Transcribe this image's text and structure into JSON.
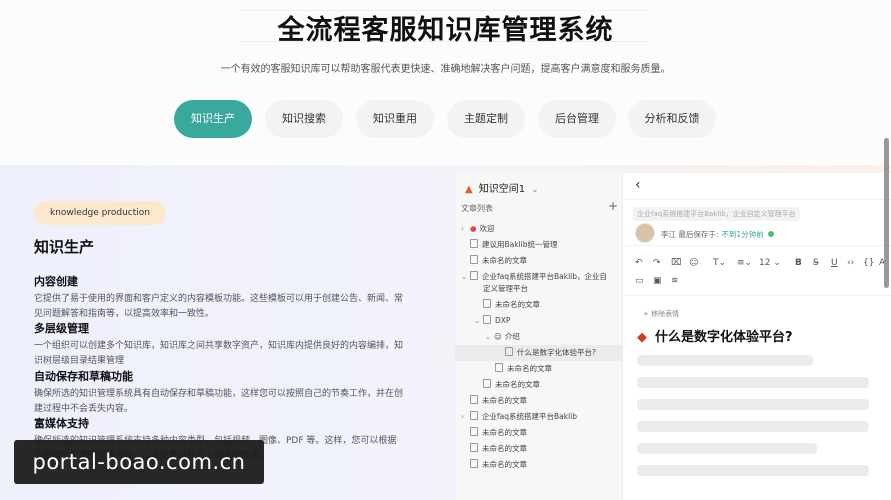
{
  "hero": {
    "title": "全流程客服知识库管理系统",
    "subtitle": "一个有效的客服知识库可以帮助客服代表更快速、准确地解决客户问题，提高客户满意度和服务质量。"
  },
  "tabs": [
    {
      "label": "知识生产",
      "active": true
    },
    {
      "label": "知识搜索",
      "active": false
    },
    {
      "label": "知识重用",
      "active": false
    },
    {
      "label": "主题定制",
      "active": false
    },
    {
      "label": "后台管理",
      "active": false
    },
    {
      "label": "分析和反馈",
      "active": false
    }
  ],
  "section": {
    "pill": "knowledge production",
    "title": "知识生产",
    "features": [
      {
        "title": "内容创建",
        "text": "它提供了易于使用的界面和客户定义的内容模板功能。这些模板可以用于创建公告、新闻、常见问题解答和指南等，以提高效率和一致性。"
      },
      {
        "title": "多层级管理",
        "text": "一个组织可以创建多个知识库，知识库之间共享数字资产，知识库内提供良好的内容编排，知识树层级目录结果管理"
      },
      {
        "title": "自动保存和草稿功能",
        "text": "确保所选的知识管理系统具有自动保存和草稿功能，这样您可以按照自己的节奏工作，并在创建过程中不会丢失内容。"
      },
      {
        "title": "富媒体支持",
        "text": "确保所选的知识管理系统支持多种内容类型，包括视频、图像、PDF 等。这样，您可以根据需要提供丰富的媒体内容，以满足客户和员工的不同需求。"
      }
    ]
  },
  "panel": {
    "space_name": "知识空间1",
    "list_label": "文章列表",
    "tree": [
      {
        "label": "欢迎",
        "type": "pin",
        "arrow": "›"
      },
      {
        "label": "建议用Baklib统一管理",
        "type": "doc"
      },
      {
        "label": "未命名的文章",
        "type": "doc"
      },
      {
        "label": "企业faq系统搭建平台Baklib，企业自",
        "type": "doc",
        "arrow": "⌄"
      },
      {
        "label": "定义管理平台",
        "type": "none"
      },
      {
        "label": "未命名的文章",
        "type": "doc"
      },
      {
        "label": "DXP",
        "type": "doc",
        "arrow": "⌄"
      },
      {
        "label": "介绍",
        "type": "emoji",
        "arrow": "⌄"
      },
      {
        "label": "什么是数字化体验平台?",
        "type": "doc",
        "selected": true
      },
      {
        "label": "未命名的文章",
        "type": "doc"
      },
      {
        "label": "未命名的文章",
        "type": "doc"
      },
      {
        "label": "未命名的文章",
        "type": "doc"
      },
      {
        "label": "企业faq系统搭建平台Baklib",
        "type": "doc",
        "arrow": "›"
      },
      {
        "label": "未命名的文章",
        "type": "doc"
      },
      {
        "label": "未命名的文章",
        "type": "doc"
      },
      {
        "label": "未命名的文章",
        "type": "doc"
      }
    ],
    "editor": {
      "breadcrumb": "企业faq系统搭建平台Baklib，企业自定义管理平台",
      "author": "李江 最后保存于:",
      "saved_time": "不到1分钟前",
      "font_size": "12",
      "cover_action": "+ 移除表情",
      "doc_title": "什么是数字化体验平台?"
    }
  },
  "watermark": "portal-boao.com.cn"
}
